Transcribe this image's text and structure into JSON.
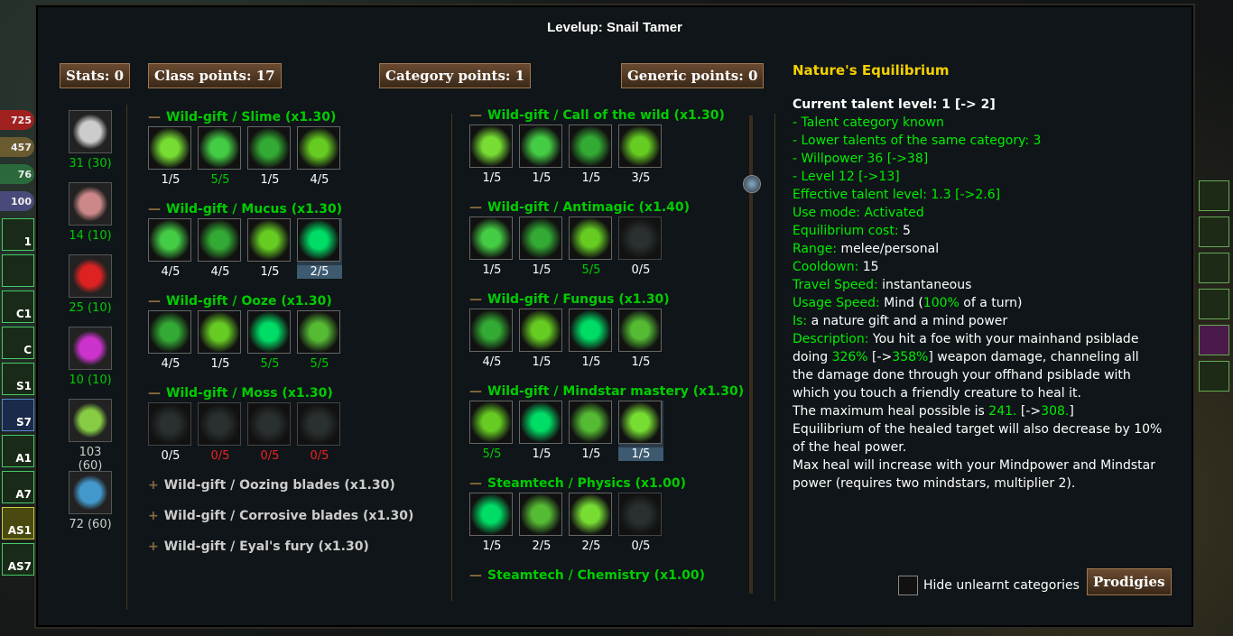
{
  "title": "Levelup: Snail Tamer",
  "points": {
    "stats": "Stats: 0",
    "class": "Class points: 17",
    "category": "Category points: 1",
    "generic": "Generic points: 0"
  },
  "left_hud": {
    "pills": [
      "725",
      "457",
      "76",
      "100"
    ],
    "hotkeys": [
      "1",
      "",
      "C1",
      "C",
      "S1",
      "S7",
      "A1",
      "A7",
      "AS1",
      "AS7"
    ]
  },
  "stats": [
    {
      "icon": "strength-icon",
      "value": "31 (30)",
      "green": true
    },
    {
      "icon": "dexterity-icon",
      "value": "14 (10)",
      "green": true
    },
    {
      "icon": "constitution-icon",
      "value": "25 (10)",
      "green": true
    },
    {
      "icon": "magic-icon",
      "value": "10 (10)",
      "green": true
    },
    {
      "icon": "willpower-icon",
      "value": "103 (60)",
      "green": false
    },
    {
      "icon": "cunning-icon",
      "value": "72 (60)",
      "green": false
    }
  ],
  "class_categories": [
    {
      "name": "Wild-gift / Slime (x1.30)",
      "levels": [
        "1/5",
        "5/5",
        "1/5",
        "4/5"
      ]
    },
    {
      "name": "Wild-gift / Mucus (x1.30)",
      "levels": [
        "4/5",
        "4/5",
        "1/5",
        "2/5"
      ]
    },
    {
      "name": "Wild-gift / Ooze (x1.30)",
      "levels": [
        "4/5",
        "1/5",
        "5/5",
        "5/5"
      ]
    },
    {
      "name": "Wild-gift / Moss (x1.30)",
      "levels": [
        "0/5",
        "0/5",
        "0/5",
        "0/5"
      ]
    }
  ],
  "collapsed_categories": [
    "Wild-gift / Oozing blades (x1.30)",
    "Wild-gift / Corrosive blades (x1.30)",
    "Wild-gift / Eyal's fury (x1.30)"
  ],
  "generic_categories": [
    {
      "name": "Wild-gift / Call of the wild (x1.30)",
      "levels": [
        "1/5",
        "1/5",
        "1/5",
        "3/5"
      ]
    },
    {
      "name": "Wild-gift / Antimagic (x1.40)",
      "levels": [
        "1/5",
        "1/5",
        "5/5",
        "0/5"
      ]
    },
    {
      "name": "Wild-gift / Fungus (x1.30)",
      "levels": [
        "4/5",
        "1/5",
        "1/5",
        "1/5"
      ]
    },
    {
      "name": "Wild-gift / Mindstar mastery (x1.30)",
      "levels": [
        "5/5",
        "1/5",
        "1/5",
        "1/5"
      ]
    },
    {
      "name": "Steamtech / Physics (x1.00)",
      "levels": [
        "1/5",
        "2/5",
        "2/5",
        "0/5"
      ]
    },
    {
      "name": "Steamtech / Chemistry (x1.00)",
      "levels": []
    }
  ],
  "description": {
    "heading": "Nature's Equilibrium",
    "current_level": "Current talent level: 1 [-> 2]",
    "req1": "- Talent category known",
    "req2": "- Lower talents of the same category: 3",
    "req3": "- Willpower 36 [->38]",
    "req4": "- Level 12 [->13]",
    "effective_label": "Effective talent level:",
    "effective_value": "1.3 [->2.6]",
    "use_mode_label": "Use mode:",
    "use_mode_value": "Activated",
    "eq_cost_label": "Equilibrium cost:",
    "eq_cost_value": "5",
    "range_label": "Range:",
    "range_value": "melee/personal",
    "cooldown_label": "Cooldown:",
    "cooldown_value": "15",
    "travel_label": "Travel Speed:",
    "travel_value": "instantaneous",
    "usage_label": "Usage Speed:",
    "usage_pre": "Mind (",
    "usage_pct": "100%",
    "usage_post": " of a turn)",
    "is_label": "Is:",
    "is_value": "a nature gift and a mind power",
    "desc_label": "Description:",
    "desc_1": "You hit a foe with your mainhand psiblade doing ",
    "desc_pct1": "326%",
    "desc_arrow": " [->",
    "desc_pct2": "358%",
    "desc_2": "] weapon damage, channeling all the damage done through your offhand psiblade with which you touch a friendly creature to heal it.",
    "heal_pre": "The maximum heal possible is ",
    "heal_val": "241.",
    "heal_arrow": " [->",
    "heal_val2": "308.",
    "heal_post": "]",
    "desc_3": "Equilibrium of the healed target will also decrease by 10% of the heal power.",
    "desc_4": "Max heal will increase with your Mindpower and Mindstar power (requires two mindstars, multiplier  2)."
  },
  "hide_unlearnt_label": "Hide unlearnt categories",
  "prodigies_label": "Prodigies"
}
